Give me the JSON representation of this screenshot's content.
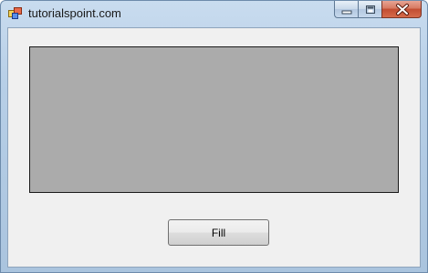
{
  "window": {
    "title": "tutorialspoint.com"
  },
  "caption_buttons": {
    "minimize_icon": "minimize-icon",
    "maximize_icon": "maximize-icon",
    "close_icon": "close-icon"
  },
  "panel": {
    "color": "#ababab"
  },
  "fill_button": {
    "label": "Fill"
  }
}
